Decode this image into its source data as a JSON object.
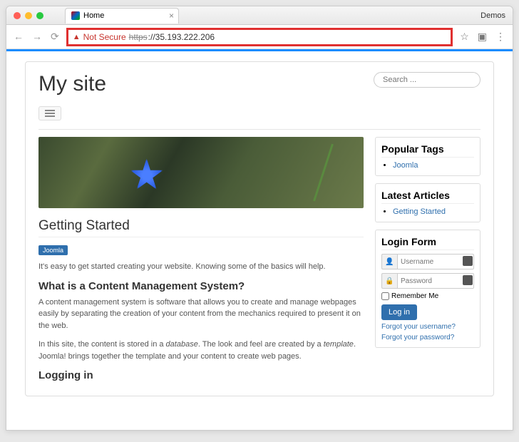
{
  "browser": {
    "tab_title": "Home",
    "demos_label": "Demos",
    "not_secure": "Not Secure",
    "https_prefix": "https",
    "url_rest": "://35.193.222.206"
  },
  "site": {
    "title": "My site",
    "search_placeholder": "Search ..."
  },
  "article": {
    "title": "Getting Started",
    "tag": "Joomla",
    "intro": "It's easy to get started creating your website. Knowing some of the basics will help.",
    "h2_1": "What is a Content Management System?",
    "p1": "A content management system is software that allows you to create and manage webpages easily by separating the creation of your content from the mechanics required to present it on the web.",
    "p2_a": "In this site, the content is stored in a ",
    "p2_db": "database",
    "p2_b": ". The look and feel are created by a ",
    "p2_tmpl": "template",
    "p2_c": ". Joomla! brings together the template and your content to create web pages.",
    "h2_2": "Logging in"
  },
  "sidebar": {
    "popular_tags_title": "Popular Tags",
    "popular_tags": [
      "Joomla"
    ],
    "latest_title": "Latest Articles",
    "latest_items": [
      "Getting Started"
    ],
    "login_title": "Login Form",
    "username_placeholder": "Username",
    "password_placeholder": "Password",
    "remember": "Remember Me",
    "login_btn": "Log in",
    "forgot_user": "Forgot your username?",
    "forgot_pass": "Forgot your password?"
  }
}
